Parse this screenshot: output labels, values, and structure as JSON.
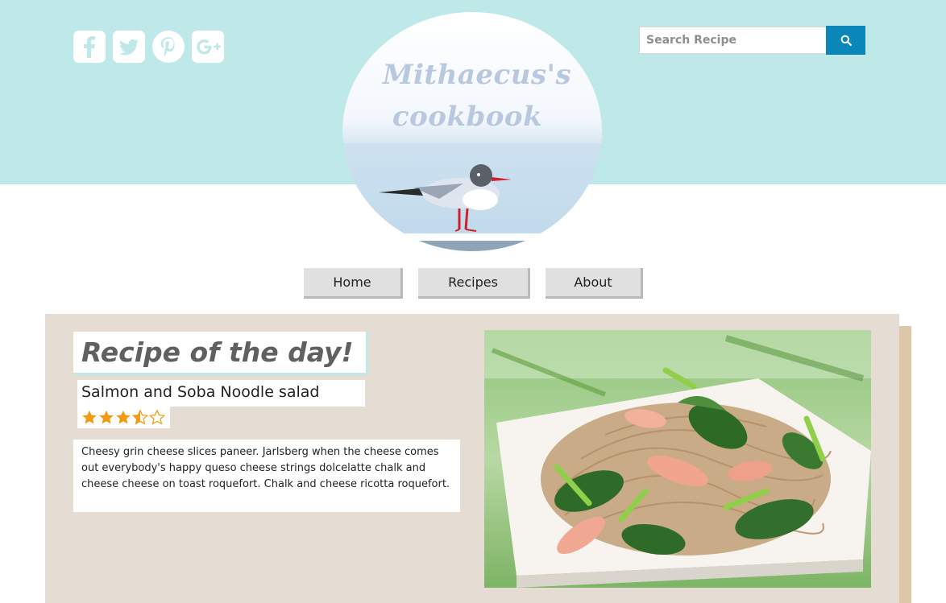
{
  "social": [
    {
      "name": "facebook",
      "icon": "facebook-icon"
    },
    {
      "name": "twitter",
      "icon": "twitter-icon"
    },
    {
      "name": "pinterest",
      "icon": "pinterest-icon"
    },
    {
      "name": "google-plus",
      "icon": "google-plus-icon"
    }
  ],
  "search": {
    "placeholder": "Search Recipe",
    "value": "",
    "icon": "search-icon"
  },
  "logo": {
    "line1": "Mithaecus's",
    "line2": "cookbook"
  },
  "nav": {
    "items": [
      {
        "label": "Home"
      },
      {
        "label": "Recipes"
      },
      {
        "label": "About"
      }
    ]
  },
  "featured": {
    "heading": "Recipe of the day!",
    "name": "Salmon and Soba Noodle salad",
    "rating": 3.5,
    "rating_max": 5,
    "description": "Cheesy grin cheese slices paneer. Jarlsberg when the cheese comes out everybody's happy queso cheese strings dolcelatte chalk and cheese cheese on toast roquefort. Chalk and cheese ricotta roquefort."
  },
  "colors": {
    "header_band": "#bfe8e8",
    "search_button": "#0a87b8",
    "panel": "#e5ddd3",
    "star": "#f29b11",
    "nav_button": "#e0e0e0"
  }
}
